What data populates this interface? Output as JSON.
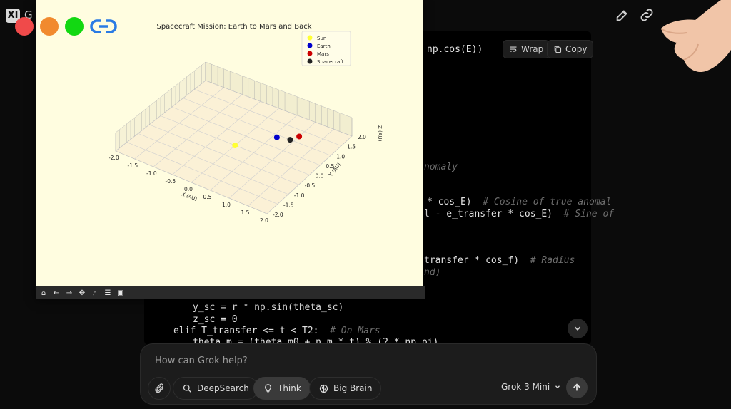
{
  "app": {
    "logo": "XI",
    "title_fragment": "G"
  },
  "code": {
    "wrap_label": "Wrap",
    "copy_label": "Copy",
    "lines": [
      {
        "code": "np.cos(E))",
        "comment": ""
      },
      {
        "code": "",
        "comment": "nomaly"
      },
      {
        "code": "* cos_E)  ",
        "comment": "# Cosine of true anomal"
      },
      {
        "code": "l - e_transfer * cos_E)  ",
        "comment": "# Sine of"
      },
      {
        "code": "transfer * cos_f)  ",
        "comment": "# Radius"
      },
      {
        "code": "",
        "comment": "nd)"
      },
      {
        "code": "y_sc = r * np.sin(theta_sc)",
        "comment": ""
      },
      {
        "code": "z_sc = 0",
        "comment": ""
      },
      {
        "code": "elif T_transfer <= t < T2:  ",
        "comment": "# On Mars"
      },
      {
        "code": "theta m = (theta m0 + n m * t) % (2 * np.pi)",
        "comment": ""
      }
    ]
  },
  "chat": {
    "placeholder": "How can Grok help?",
    "deepsearch_label": "DeepSearch",
    "think_label": "Think",
    "bigbrain_label": "Big Brain",
    "model_label": "Grok 3 Mini"
  },
  "chart_data": {
    "type": "scatter",
    "title": "Spacecraft Mission: Earth to Mars and Back",
    "xlabel": "X (AU)",
    "ylabel": "Y (AU)",
    "zlabel": "Z (AU)",
    "xlim": [
      -2.0,
      2.0
    ],
    "ylim": [
      -2.0,
      2.0
    ],
    "x_ticks": [
      "-2.0",
      "-1.5",
      "-1.0",
      "-0.5",
      "0.0",
      "0.5",
      "1.0",
      "1.5",
      "2.0"
    ],
    "y_ticks": [
      "-2.0",
      "-1.5",
      "-1.0",
      "-0.5",
      "0.0",
      "0.5",
      "1.0",
      "1.5",
      "2.0"
    ],
    "legend_position": "top-right",
    "series": [
      {
        "name": "Sun",
        "color": "#ffff33",
        "x": 0.0,
        "y": 0.0,
        "z": 0.0
      },
      {
        "name": "Earth",
        "color": "#0000cc",
        "x": 0.6,
        "y": 0.9,
        "z": 0.0
      },
      {
        "name": "Mars",
        "color": "#cc0000",
        "x": 1.0,
        "y": 1.25,
        "z": 0.0
      },
      {
        "name": "Spacecraft",
        "color": "#222222",
        "x": 0.9,
        "y": 1.0,
        "z": 0.0
      }
    ]
  },
  "window_controls": {
    "close_color": "#f04a4a",
    "minimize_color": "#f18a2e",
    "maximize_color": "#12d812",
    "link_color": "#2a7be4"
  }
}
